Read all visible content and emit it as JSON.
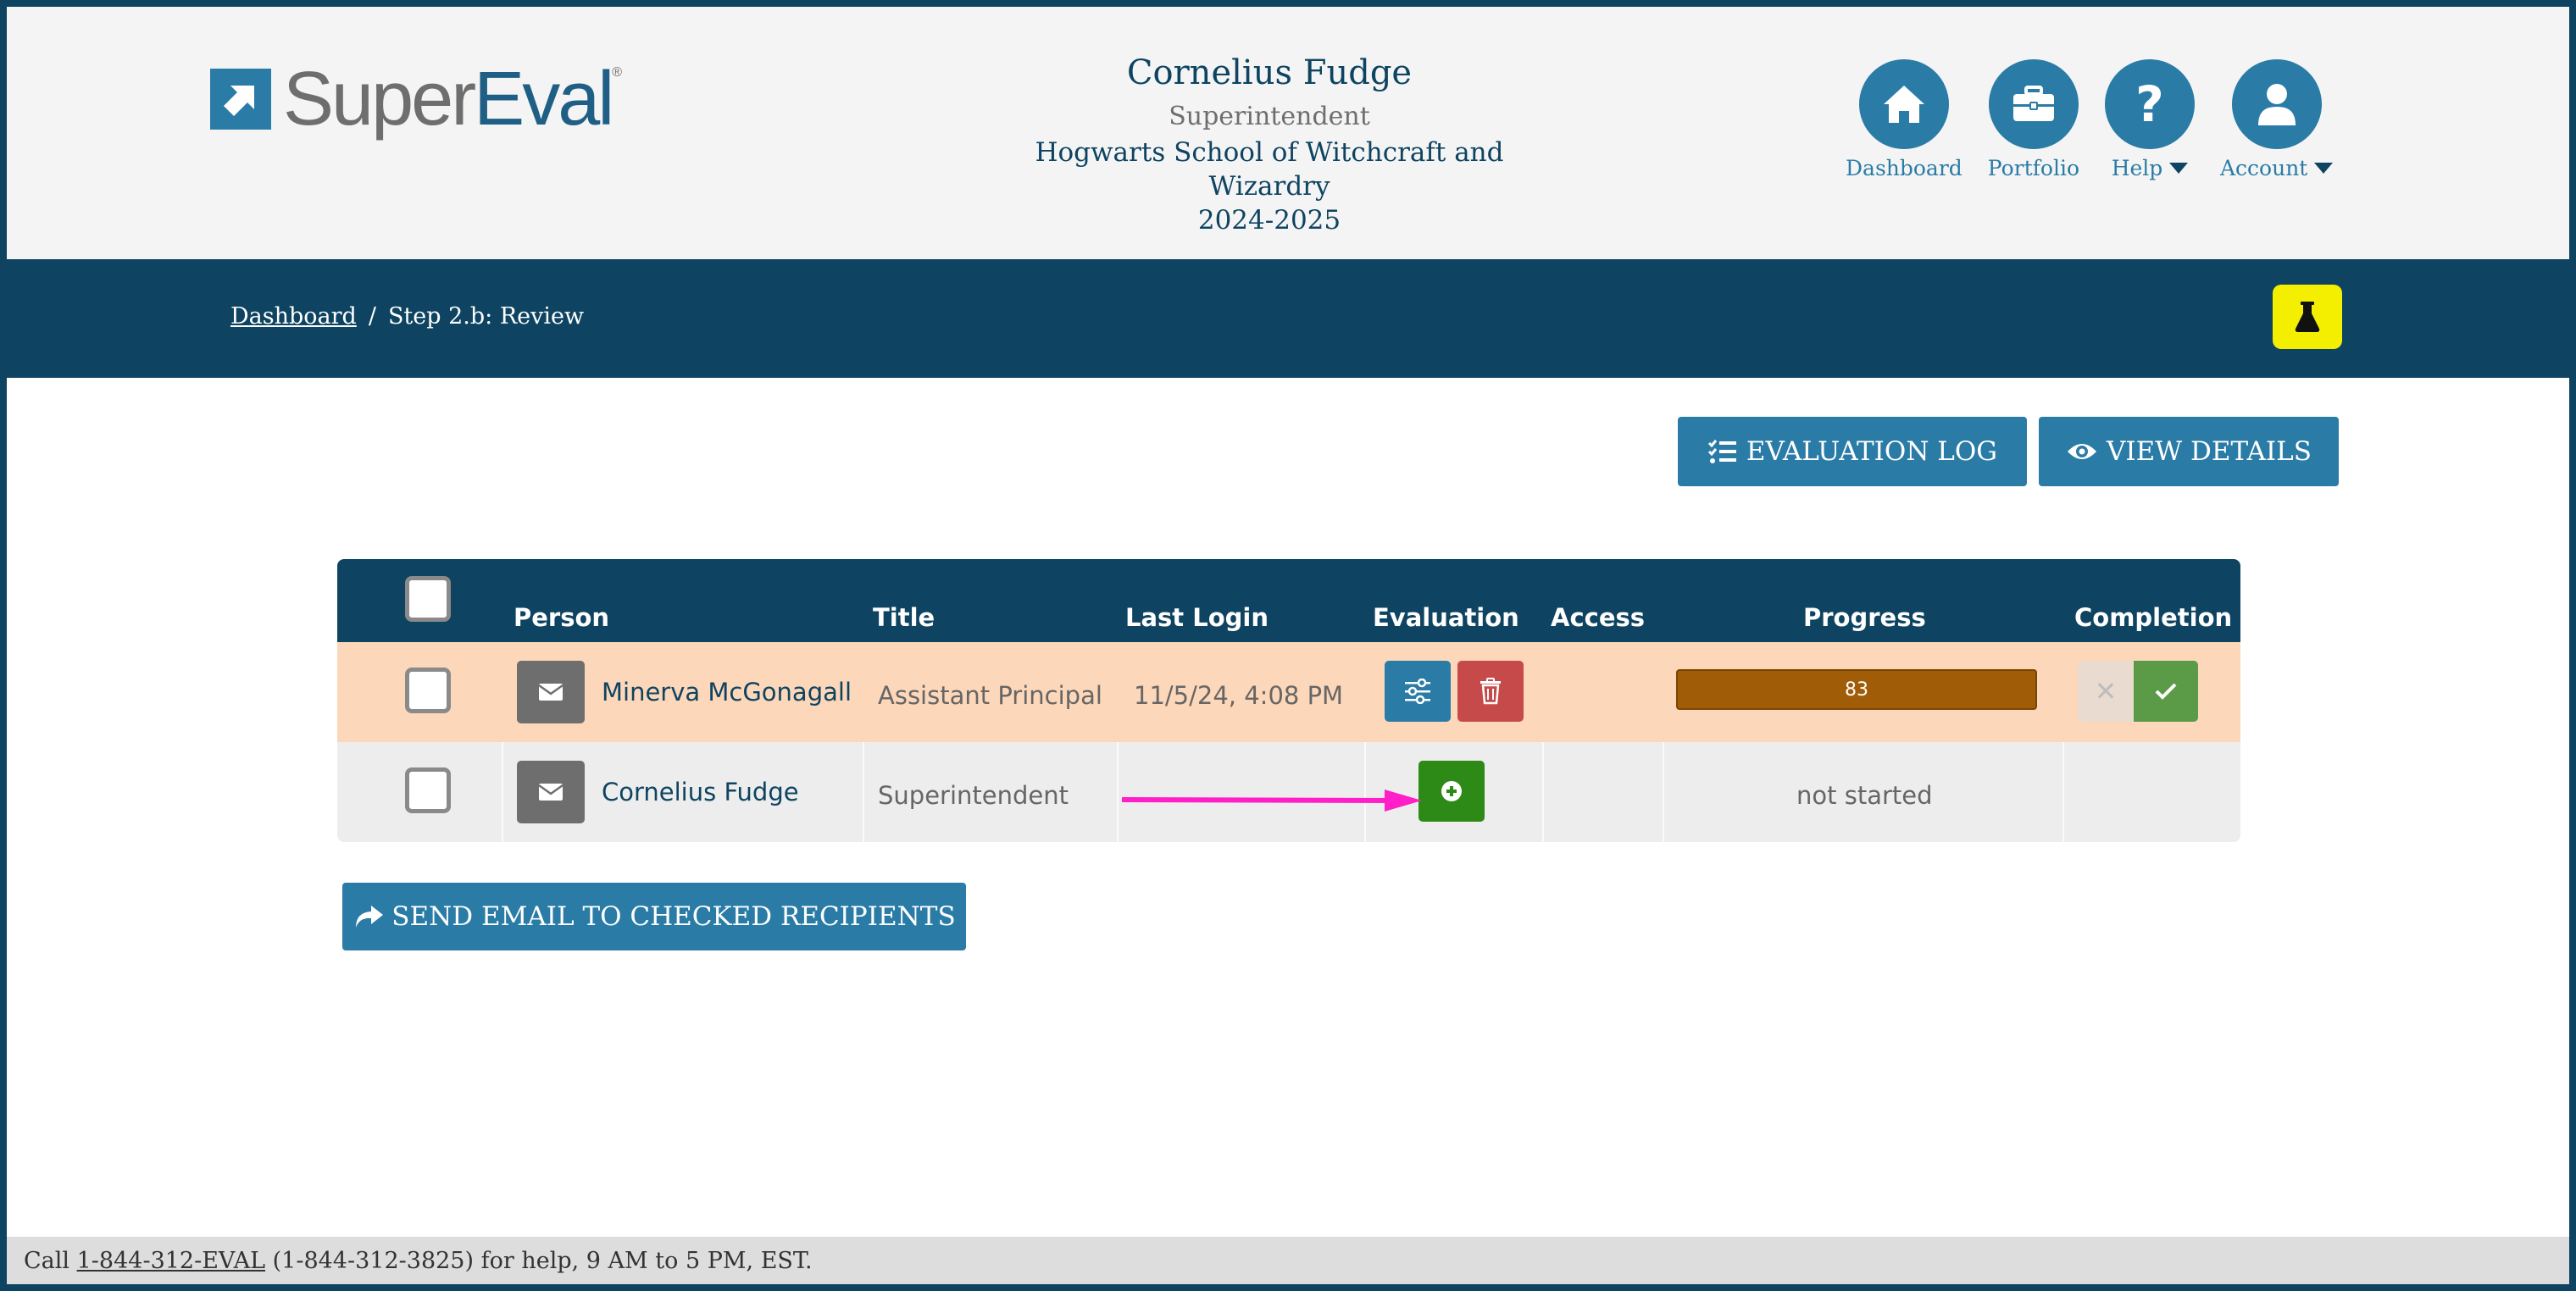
{
  "brand": {
    "super": "Super",
    "eval": "Eval",
    "reg": "®"
  },
  "user": {
    "name": "Cornelius Fudge",
    "role": "Superintendent",
    "school": "Hogwarts School of Witchcraft and Wizardry",
    "year": "2024-2025"
  },
  "nav": {
    "dashboard": "Dashboard",
    "portfolio": "Portfolio",
    "help": "Help",
    "account": "Account"
  },
  "breadcrumb": {
    "home": "Dashboard",
    "separator": "/",
    "current": "Step 2.b: Review"
  },
  "actions": {
    "evaluation_log": "EVALUATION LOG",
    "view_details": "VIEW DETAILS",
    "send_email": "SEND EMAIL TO CHECKED RECIPIENTS"
  },
  "table": {
    "headers": {
      "person": "Person",
      "title": "Title",
      "last_login": "Last Login",
      "evaluation": "Evaluation",
      "access": "Access",
      "progress": "Progress",
      "completion": "Completion"
    },
    "rows": [
      {
        "person": "Minerva McGonagall",
        "title": "Assistant Principal",
        "last_login": "11/5/24, 4:08 PM",
        "progress": "83",
        "completion_x": "✕"
      },
      {
        "person": "Cornelius Fudge",
        "title": "Superintendent",
        "last_login": "",
        "progress_text": "not started"
      }
    ]
  },
  "footer": {
    "prefix": "Call ",
    "phone_link": "1-844-312-EVAL",
    "suffix": " (1-844-312-3825) for help, 9 AM to 5 PM, EST."
  },
  "colors": {
    "navy": "#0e4461",
    "blue": "#2a7ca7",
    "row_highlight": "#fdd7b9",
    "progress": "#a05c06",
    "green": "#2e8a16",
    "red": "#c64a4a",
    "lab_yellow": "#f4ef00",
    "arrow": "#ff1ec8"
  },
  "icons": {
    "dashboard": "home-icon",
    "portfolio": "briefcase-icon",
    "help": "question-icon",
    "account": "user-icon",
    "lab": "flask-icon"
  }
}
